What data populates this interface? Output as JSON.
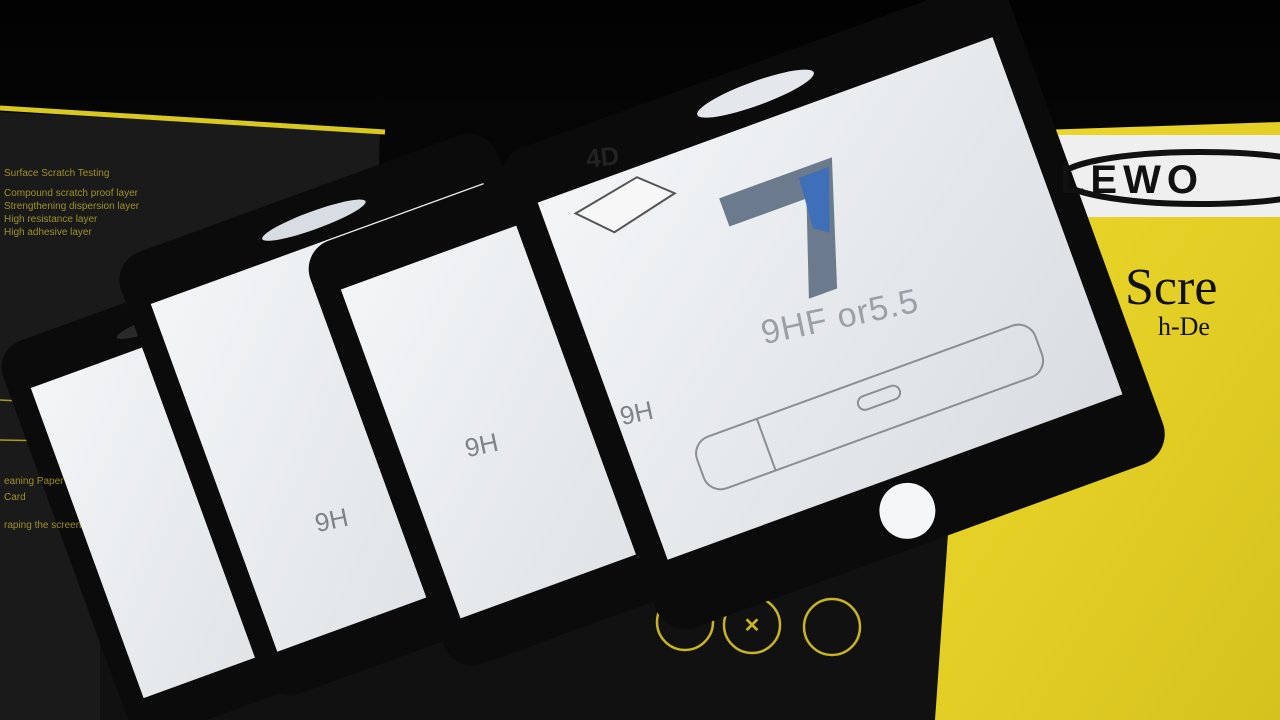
{
  "product": {
    "badge_text": "4D",
    "model_number": "7",
    "caption": "9HF or5.5",
    "caption_partial_a": "9H",
    "caption_partial_b": "9H",
    "caption_partial_c": "9H"
  },
  "packaging": {
    "brand_text": "LEWO",
    "heading_fragment": "Scre",
    "subheading_fragment": "h-De",
    "left_box_lines": [
      "Surface Scratch Testing",
      "Compound scratch proof layer",
      "Strengthening dispersion layer",
      "High resistance layer",
      "High adhesive layer"
    ],
    "left_box_footer": [
      "eaning Paper",
      "Card",
      "raping the screen"
    ]
  },
  "colors": {
    "background": "#060606",
    "yellow_card": "#e8d52a",
    "frame": "#0b0b0b",
    "glass": "#e9ecef",
    "accent_blue": "#3e6fb8"
  }
}
